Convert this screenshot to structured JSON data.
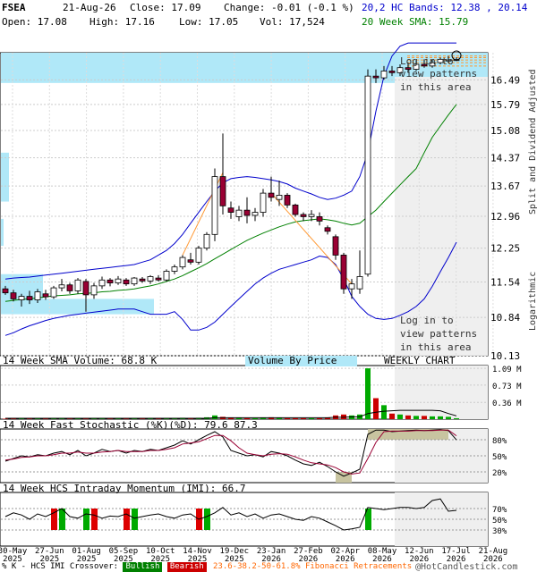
{
  "header": {
    "symbol": "FSEA",
    "date": "21-Aug-26",
    "close": "Close: 17.09",
    "change": "Change: -0.01 (-0.1 %)",
    "open": "Open: 17.08",
    "high": "High: 17.16",
    "low": "Low: 17.05",
    "vol": "Vol: 17,524",
    "bands": "20,2 HC Bands: 12.38 , 20.14",
    "sma": "20 Week SMA: 15.79"
  },
  "side_labels": {
    "adjusted": "Split and Dividend Adjusted",
    "scale": "Logarithmic"
  },
  "login_text": {
    "l1": "Log in to",
    "l2": "view patterns",
    "l3": "in this area"
  },
  "panel_labels": {
    "volume_sma": "14 Week SMA Volume: 68.8 K",
    "volume_by_price": "Volume By Price",
    "weekly": "WEEKLY CHART",
    "stoch": "14 Week Fast Stochastic (%K)(%D): 79.6  87.3",
    "imi": "14 Week HCS Intraday Momentum (IMI): 66.7"
  },
  "footer": {
    "imi_legend": "% K - HCS IMI Crossover:",
    "bullish": "Bullish",
    "bearish": "Bearish",
    "fib": "23.6-38.2-50-61.8% Fibonacci Retracements",
    "brand": "@HotCandlestick.com"
  },
  "colors": {
    "bull": "#ffffff",
    "bear": "#990033",
    "band": "#0000cc",
    "sma": "#008000",
    "vbp": "#b0e8f8",
    "fib": "#ff9933"
  },
  "chart_data": [
    {
      "type": "candlestick",
      "title": "FSEA",
      "ylabel": "Split and Dividend Adjusted",
      "yscale": "log",
      "yticks": [
        "16.49",
        "15.79",
        "15.08",
        "14.37",
        "13.67",
        "12.96",
        "12.25",
        "11.54",
        "10.84",
        "10.13"
      ],
      "yticks_values": [
        16.49,
        15.79,
        15.08,
        14.37,
        13.67,
        12.96,
        12.25,
        11.54,
        10.84,
        10.13
      ],
      "ylim": [
        10.13,
        17.3
      ],
      "x_labels": [
        [
          "30-May",
          "2025"
        ],
        [
          "27-Jun",
          "2025"
        ],
        [
          "01-Aug",
          "2025"
        ],
        [
          "05-Sep",
          "2025"
        ],
        [
          "10-Oct",
          "2025"
        ],
        [
          "14-Nov",
          "2025"
        ],
        [
          "19-Dec",
          "2025"
        ],
        [
          "23-Jan",
          "2026"
        ],
        [
          "27-Feb",
          "2026"
        ],
        [
          "02-Apr",
          "2026"
        ],
        [
          "08-May",
          "2026"
        ],
        [
          "12-Jun",
          "2026"
        ],
        [
          "17-Jul",
          "2026"
        ],
        [
          "21-Aug",
          "2026"
        ]
      ],
      "candles": [
        [
          11.4,
          11.46,
          11.28,
          11.32
        ],
        [
          11.32,
          11.38,
          11.15,
          11.2
        ],
        [
          11.18,
          11.3,
          11.05,
          11.25
        ],
        [
          11.25,
          11.36,
          11.1,
          11.18
        ],
        [
          11.18,
          11.4,
          11.12,
          11.34
        ],
        [
          11.3,
          11.38,
          11.18,
          11.24
        ],
        [
          11.24,
          11.46,
          11.2,
          11.42
        ],
        [
          11.42,
          11.6,
          11.35,
          11.48
        ],
        [
          11.48,
          11.52,
          11.3,
          11.36
        ],
        [
          11.36,
          11.62,
          11.3,
          11.58
        ],
        [
          11.55,
          11.6,
          10.95,
          11.28
        ],
        [
          11.28,
          11.52,
          11.2,
          11.46
        ],
        [
          11.46,
          11.65,
          11.4,
          11.58
        ],
        [
          11.58,
          11.62,
          11.45,
          11.52
        ],
        [
          11.52,
          11.66,
          11.48,
          11.6
        ],
        [
          11.58,
          11.62,
          11.46,
          11.5
        ],
        [
          11.5,
          11.64,
          11.46,
          11.62
        ],
        [
          11.6,
          11.64,
          11.52,
          11.56
        ],
        [
          11.56,
          11.68,
          11.5,
          11.65
        ],
        [
          11.62,
          11.68,
          11.55,
          11.58
        ],
        [
          11.58,
          11.8,
          11.55,
          11.76
        ],
        [
          11.76,
          11.9,
          11.7,
          11.85
        ],
        [
          11.85,
          12.1,
          11.8,
          12.05
        ],
        [
          12.0,
          12.15,
          11.9,
          11.95
        ],
        [
          11.95,
          12.3,
          11.9,
          12.25
        ],
        [
          12.25,
          12.6,
          12.2,
          12.55
        ],
        [
          12.55,
          14.1,
          12.4,
          13.9
        ],
        [
          13.9,
          15.0,
          13.0,
          13.2
        ],
        [
          13.15,
          13.3,
          12.9,
          13.05
        ],
        [
          12.95,
          13.2,
          12.85,
          13.1
        ],
        [
          13.1,
          13.4,
          12.8,
          12.98
        ],
        [
          12.98,
          13.15,
          12.85,
          13.05
        ],
        [
          13.05,
          13.6,
          12.95,
          13.5
        ],
        [
          13.5,
          13.9,
          13.3,
          13.4
        ],
        [
          13.35,
          13.8,
          13.2,
          13.45
        ],
        [
          13.45,
          13.5,
          13.15,
          13.22
        ],
        [
          13.22,
          13.25,
          12.95,
          13.0
        ],
        [
          13.0,
          13.05,
          12.85,
          12.95
        ],
        [
          12.95,
          13.1,
          12.85,
          13.0
        ],
        [
          12.95,
          13.05,
          12.75,
          12.85
        ],
        [
          12.7,
          12.75,
          12.55,
          12.62
        ],
        [
          12.5,
          12.55,
          12.0,
          12.1
        ],
        [
          12.1,
          12.15,
          11.3,
          11.4
        ],
        [
          11.4,
          11.6,
          11.2,
          11.5
        ],
        [
          11.4,
          12.2,
          11.3,
          11.65
        ],
        [
          11.7,
          16.8,
          11.65,
          16.6
        ],
        [
          16.6,
          16.8,
          16.4,
          16.55
        ],
        [
          16.55,
          16.9,
          16.5,
          16.75
        ],
        [
          16.75,
          16.9,
          16.6,
          16.7
        ],
        [
          16.7,
          16.95,
          16.6,
          16.85
        ],
        [
          16.85,
          17.0,
          16.7,
          16.8
        ],
        [
          16.8,
          17.05,
          16.75,
          16.95
        ],
        [
          16.95,
          17.1,
          16.85,
          16.9
        ],
        [
          16.9,
          17.1,
          16.85,
          17.0
        ],
        [
          17.0,
          17.15,
          16.95,
          17.1
        ],
        [
          17.05,
          17.2,
          17.0,
          17.08
        ],
        [
          17.08,
          17.16,
          17.05,
          17.09
        ]
      ],
      "upper_band": [
        11.6,
        11.62,
        11.63,
        11.64,
        11.66,
        11.68,
        11.7,
        11.72,
        11.74,
        11.76,
        11.78,
        11.8,
        11.82,
        11.84,
        11.86,
        11.88,
        11.9,
        11.95,
        12.0,
        12.1,
        12.2,
        12.35,
        12.55,
        12.8,
        13.05,
        13.3,
        13.55,
        13.75,
        13.85,
        13.88,
        13.9,
        13.88,
        13.85,
        13.82,
        13.78,
        13.72,
        13.62,
        13.55,
        13.48,
        13.4,
        13.35,
        13.38,
        13.45,
        13.55,
        13.9,
        14.5,
        15.6,
        16.6,
        17.2,
        17.5,
        17.6,
        17.6,
        17.6,
        17.6,
        17.6,
        17.6,
        17.6
      ],
      "sma20": [
        11.15,
        11.17,
        11.19,
        11.2,
        11.22,
        11.24,
        11.26,
        11.27,
        11.28,
        11.3,
        11.31,
        11.32,
        11.34,
        11.35,
        11.37,
        11.38,
        11.4,
        11.43,
        11.46,
        11.5,
        11.55,
        11.6,
        11.67,
        11.75,
        11.83,
        11.92,
        12.02,
        12.12,
        12.22,
        12.32,
        12.42,
        12.5,
        12.58,
        12.65,
        12.72,
        12.78,
        12.83,
        12.86,
        12.88,
        12.9,
        12.88,
        12.85,
        12.8,
        12.76,
        12.8,
        12.95,
        13.1,
        13.3,
        13.5,
        13.7,
        13.9,
        14.1,
        14.5,
        14.9,
        15.2,
        15.5,
        15.79
      ],
      "lower_band": [
        10.5,
        10.55,
        10.62,
        10.68,
        10.73,
        10.78,
        10.82,
        10.85,
        10.88,
        10.9,
        10.92,
        10.94,
        10.96,
        10.98,
        11.0,
        11.0,
        11.0,
        10.95,
        10.9,
        10.9,
        10.9,
        10.95,
        10.8,
        10.6,
        10.6,
        10.65,
        10.75,
        10.9,
        11.05,
        11.2,
        11.35,
        11.5,
        11.62,
        11.72,
        11.8,
        11.85,
        11.9,
        11.95,
        12.0,
        12.08,
        12.05,
        11.9,
        11.6,
        11.25,
        11.05,
        10.9,
        10.82,
        10.8,
        10.82,
        10.88,
        10.95,
        11.05,
        11.2,
        11.45,
        11.75,
        12.05,
        12.38
      ],
      "annotation": "Log in to view patterns in this area"
    },
    {
      "type": "bar",
      "title": "14 Week SMA Volume: 68.8 K",
      "yticks": [
        "1.09 M",
        "0.73 M",
        "0.36 M"
      ],
      "yticks_values": [
        1.09,
        0.73,
        0.36
      ],
      "ylim": [
        0,
        1.15
      ],
      "unit": "M",
      "values": [
        0.01,
        0.01,
        0.01,
        0.01,
        0.01,
        0.02,
        0.01,
        0.01,
        0.01,
        0.01,
        0.02,
        0.01,
        0.01,
        0.01,
        0.02,
        0.01,
        0.01,
        0.02,
        0.02,
        0.02,
        0.02,
        0.02,
        0.03,
        0.02,
        0.03,
        0.04,
        0.08,
        0.05,
        0.03,
        0.03,
        0.02,
        0.02,
        0.03,
        0.04,
        0.03,
        0.02,
        0.02,
        0.02,
        0.02,
        0.02,
        0.03,
        0.08,
        0.1,
        0.08,
        0.1,
        1.09,
        0.45,
        0.3,
        0.12,
        0.1,
        0.08,
        0.07,
        0.07,
        0.06,
        0.06,
        0.05,
        0.02
      ],
      "sma": [
        0.02,
        0.02,
        0.02,
        0.02,
        0.02,
        0.02,
        0.02,
        0.02,
        0.02,
        0.02,
        0.02,
        0.02,
        0.02,
        0.02,
        0.02,
        0.02,
        0.02,
        0.02,
        0.02,
        0.02,
        0.02,
        0.02,
        0.02,
        0.02,
        0.02,
        0.02,
        0.03,
        0.03,
        0.03,
        0.03,
        0.03,
        0.03,
        0.03,
        0.03,
        0.03,
        0.03,
        0.03,
        0.03,
        0.03,
        0.03,
        0.03,
        0.04,
        0.04,
        0.05,
        0.05,
        0.12,
        0.15,
        0.17,
        0.18,
        0.19,
        0.19,
        0.19,
        0.19,
        0.19,
        0.18,
        0.12,
        0.07
      ]
    },
    {
      "type": "line",
      "title": "14 Week Fast Stochastic (%K)(%D): 79.6  87.3",
      "yticks": [
        "80%",
        "50%",
        "20%"
      ],
      "yticks_values": [
        80,
        50,
        20
      ],
      "ylim": [
        0,
        100
      ],
      "series": [
        {
          "name": "%K",
          "values": [
            40,
            45,
            50,
            48,
            52,
            50,
            55,
            58,
            52,
            60,
            50,
            55,
            62,
            58,
            60,
            55,
            60,
            58,
            62,
            60,
            65,
            70,
            78,
            72,
            80,
            88,
            95,
            85,
            60,
            55,
            50,
            52,
            48,
            58,
            55,
            50,
            42,
            35,
            32,
            38,
            30,
            20,
            12,
            18,
            25,
            90,
            98,
            98,
            95,
            96,
            97,
            98,
            97,
            98,
            99,
            97,
            79.6
          ]
        },
        {
          "name": "%D",
          "values": [
            42,
            44,
            47,
            48,
            50,
            50,
            52,
            55,
            55,
            57,
            55,
            55,
            57,
            58,
            60,
            58,
            58,
            58,
            60,
            60,
            62,
            65,
            72,
            74,
            76,
            82,
            88,
            88,
            78,
            65,
            55,
            52,
            50,
            53,
            54,
            53,
            48,
            42,
            37,
            35,
            33,
            28,
            20,
            16,
            18,
            45,
            75,
            95,
            96,
            96,
            96,
            97,
            97,
            97,
            98,
            98,
            87.3
          ]
        }
      ]
    },
    {
      "type": "line",
      "title": "14 Week HCS Intraday Momentum (IMI): 66.7",
      "yticks": [
        "70%",
        "50%",
        "30%"
      ],
      "yticks_values": [
        70,
        50,
        30
      ],
      "ylim": [
        0,
        100
      ],
      "series": [
        {
          "name": "IMI",
          "values": [
            55,
            62,
            58,
            50,
            60,
            55,
            62,
            70,
            55,
            52,
            60,
            58,
            52,
            56,
            55,
            60,
            52,
            55,
            58,
            60,
            55,
            52,
            58,
            60,
            50,
            55,
            62,
            72,
            58,
            62,
            55,
            60,
            52,
            58,
            60,
            55,
            50,
            48,
            55,
            52,
            45,
            38,
            30,
            32,
            35,
            72,
            70,
            68,
            70,
            72,
            72,
            70,
            72,
            85,
            88,
            65,
            66.7
          ]
        }
      ],
      "crossovers": [
        {
          "index": 6,
          "kind": "bearish"
        },
        {
          "index": 7,
          "kind": "bullish"
        },
        {
          "index": 10,
          "kind": "bullish"
        },
        {
          "index": 11,
          "kind": "bearish"
        },
        {
          "index": 15,
          "kind": "bearish"
        },
        {
          "index": 16,
          "kind": "bullish"
        },
        {
          "index": 24,
          "kind": "bearish"
        },
        {
          "index": 25,
          "kind": "bullish"
        },
        {
          "index": 45,
          "kind": "bullish"
        }
      ]
    }
  ]
}
